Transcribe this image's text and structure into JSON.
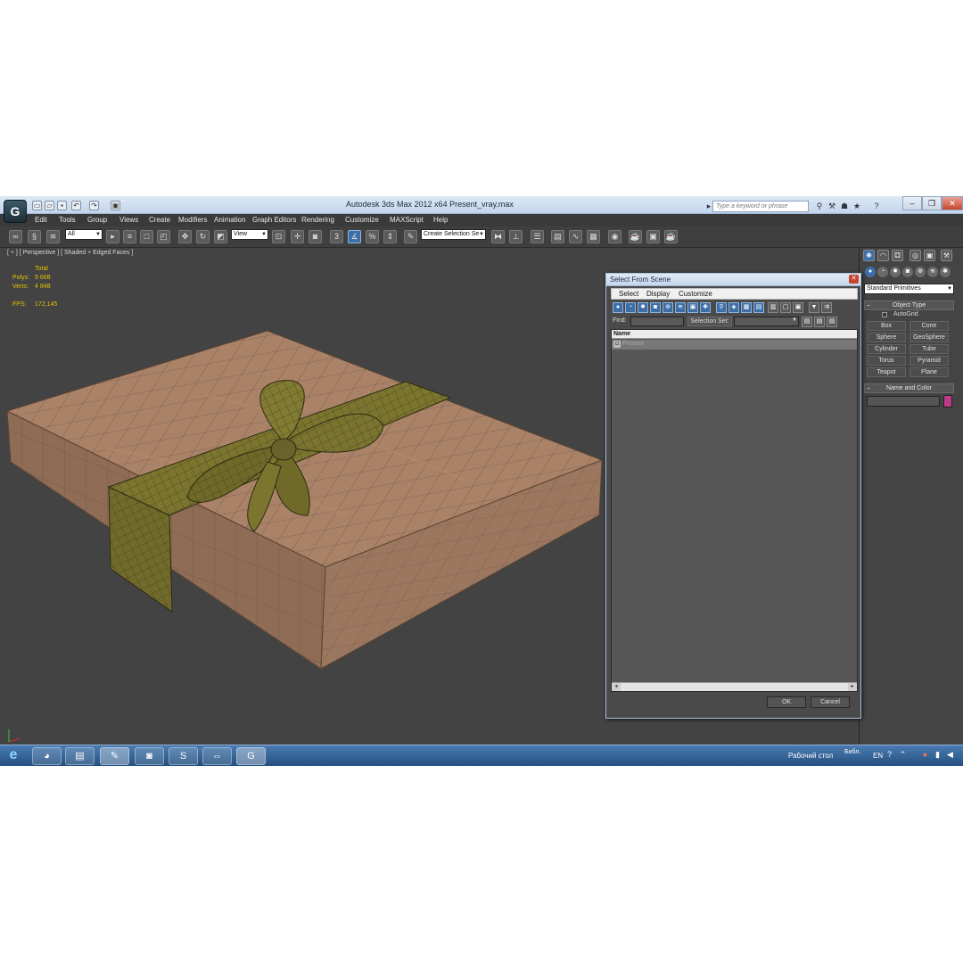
{
  "titlebar": {
    "app_logo": "G",
    "title": "Autodesk 3ds Max  2012 x64      Present_vray.max",
    "search_placeholder": "Type a keyword or phrase"
  },
  "menu": [
    "Edit",
    "Tools",
    "Group",
    "Views",
    "Create",
    "Modifiers",
    "Animation",
    "Graph Editors",
    "Rendering",
    "Customize",
    "MAXScript",
    "Help"
  ],
  "toolbar": {
    "filter_value": "All",
    "refcoord_value": "View",
    "selection_set_value": "Create Selection Se"
  },
  "viewport": {
    "label": "[ + ] [ Perspective ] [ Shaded + Edged Faces ]",
    "stats_total": "Total",
    "polys_label": "Polys:",
    "polys_value": "9 668",
    "verts_label": "Verts:",
    "verts_value": "4 848",
    "fps_label": "FPS:",
    "fps_value": "172,145"
  },
  "command_panel": {
    "dropdown_value": "Standard Primitives",
    "object_type_title": "Object Type",
    "autogrid_label": "AutoGrid",
    "primitives": [
      "Box",
      "Cone",
      "Sphere",
      "GeoSphere",
      "Cylinder",
      "Tube",
      "Torus",
      "Pyramid",
      "Teapot",
      "Plane"
    ],
    "name_color_title": "Name and Color",
    "object_color": "#c03a8a"
  },
  "dialog": {
    "title": "Select From Scene",
    "menu": [
      "Select",
      "Display",
      "Customize"
    ],
    "find_label": "Find:",
    "selection_set_label": "Selection Set:",
    "column_name": "Name",
    "rows": [
      "Present"
    ],
    "ok_label": "OK",
    "cancel_label": "Cancel"
  },
  "taskbar": {
    "desktop_label": "Рабочий стол",
    "library_label": "Библ.",
    "language": "EN"
  },
  "colors": {
    "box": "#a47d62",
    "ribbon": "#6f6a2a",
    "accent_blue": "#3c6fa8"
  }
}
